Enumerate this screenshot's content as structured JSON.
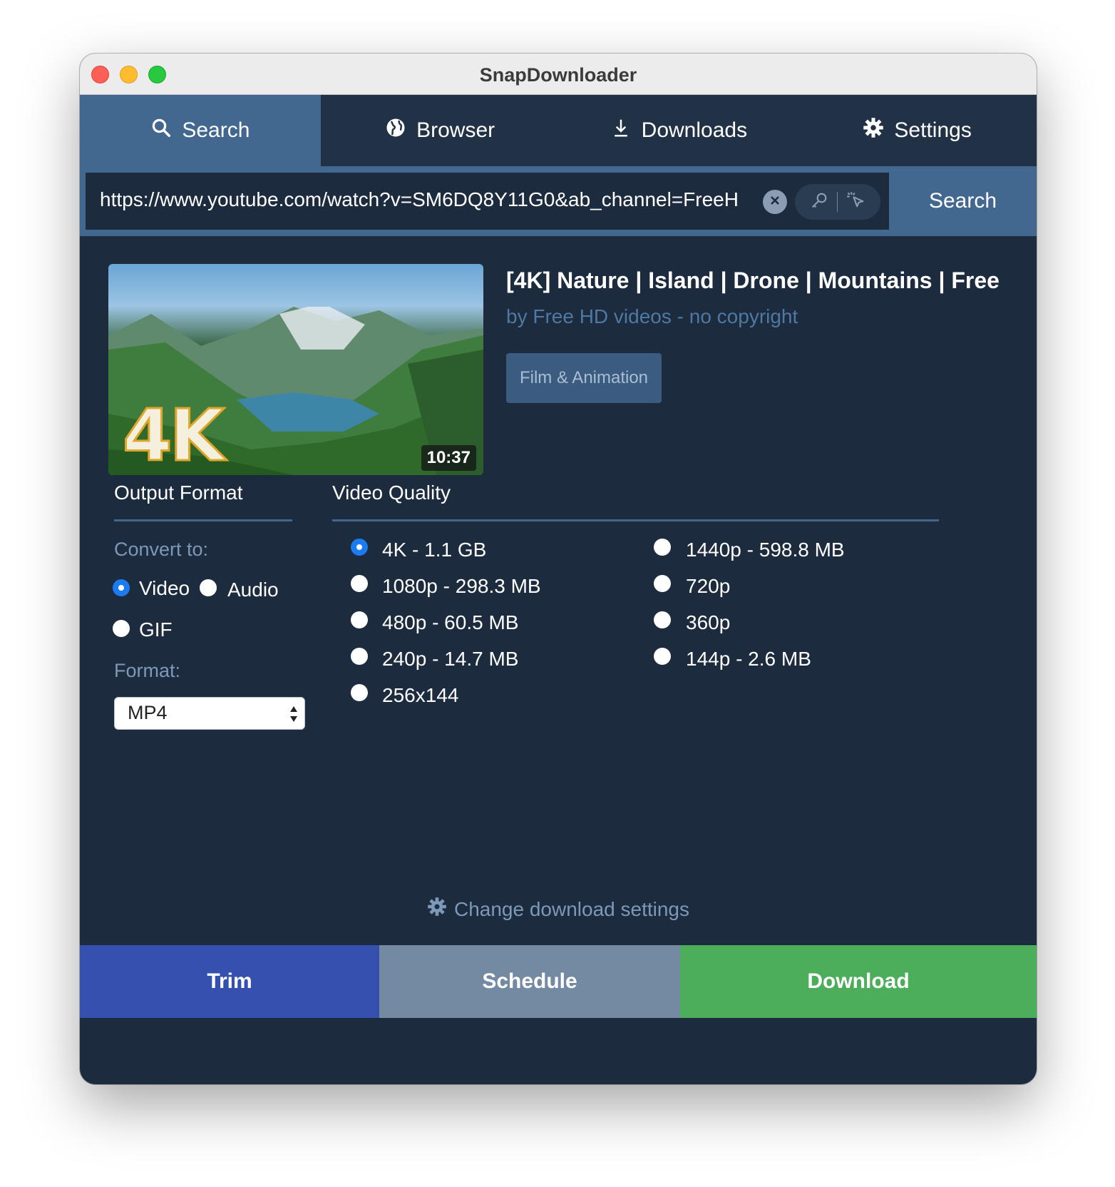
{
  "window": {
    "title": "SnapDownloader"
  },
  "tabs": [
    {
      "label": "Search",
      "icon": "search-icon",
      "active": true
    },
    {
      "label": "Browser",
      "icon": "globe-icon",
      "active": false
    },
    {
      "label": "Downloads",
      "icon": "download-icon",
      "active": false
    },
    {
      "label": "Settings",
      "icon": "gear-icon",
      "active": false
    }
  ],
  "search": {
    "url": "https://www.youtube.com/watch?v=SM6DQ8Y11G0&ab_channel=FreeH",
    "button_label": "Search"
  },
  "video": {
    "title": "[4K] Nature | Island | Drone | Mountains | Free ...",
    "channel": "by Free HD videos - no copyright",
    "category": "Film & Animation",
    "thumbnail_overlay": "4K",
    "duration": "10:37"
  },
  "output_format": {
    "heading": "Output Format",
    "convert_label": "Convert to:",
    "options": [
      {
        "label": "Video",
        "checked": true
      },
      {
        "label": "Audio",
        "checked": false
      },
      {
        "label": "GIF",
        "checked": false
      }
    ],
    "format_label": "Format:",
    "format_value": "MP4"
  },
  "video_quality": {
    "heading": "Video Quality",
    "options": [
      {
        "label": "4K - 1.1 GB",
        "checked": true
      },
      {
        "label": "1440p - 598.8 MB",
        "checked": false
      },
      {
        "label": "1080p - 298.3 MB",
        "checked": false
      },
      {
        "label": "720p",
        "checked": false
      },
      {
        "label": "480p - 60.5 MB",
        "checked": false
      },
      {
        "label": "360p",
        "checked": false
      },
      {
        "label": "240p - 14.7 MB",
        "checked": false
      },
      {
        "label": "144p - 2.6 MB",
        "checked": false
      },
      {
        "label": "256x144",
        "checked": false
      }
    ]
  },
  "footer": {
    "change_settings": "Change download settings",
    "trim": "Trim",
    "schedule": "Schedule",
    "download": "Download"
  },
  "colors": {
    "background": "#1c2b3e",
    "tab_bar": "#223246",
    "accent_blue": "#436890",
    "trim": "#3650b0",
    "schedule": "#748aa2",
    "download": "#4cae5a",
    "radio_checked": "#1a7cf0"
  }
}
